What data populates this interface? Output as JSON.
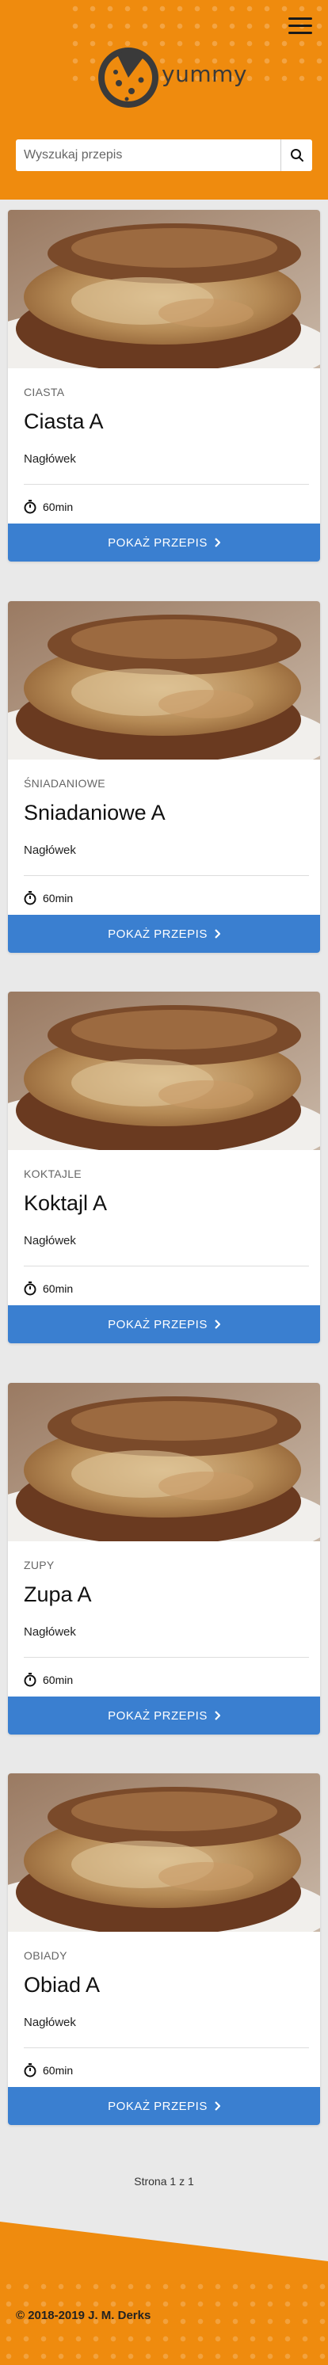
{
  "brand": {
    "name": "yummy",
    "accent": "#ef8b0e",
    "button_color": "#3a7fd0"
  },
  "header": {
    "menu_icon": "hamburger-icon"
  },
  "search": {
    "placeholder": "Wyszukaj przepis",
    "value": "",
    "icon": "search-icon"
  },
  "recipes": [
    {
      "category": "CIASTA",
      "title": "Ciasta A",
      "subtitle": "Nagłówek",
      "time": "60min",
      "button": "POKAŻ PRZEPIS"
    },
    {
      "category": "ŚNIADANIOWE",
      "title": "Sniadaniowe A",
      "subtitle": "Nagłówek",
      "time": "60min",
      "button": "POKAŻ PRZEPIS"
    },
    {
      "category": "KOKTAJLE",
      "title": "Koktajl A",
      "subtitle": "Nagłówek",
      "time": "60min",
      "button": "POKAŻ PRZEPIS"
    },
    {
      "category": "ZUPY",
      "title": "Zupa A",
      "subtitle": "Nagłówek",
      "time": "60min",
      "button": "POKAŻ PRZEPIS"
    },
    {
      "category": "OBIADY",
      "title": "Obiad A",
      "subtitle": "Nagłówek",
      "time": "60min",
      "button": "POKAŻ PRZEPIS"
    }
  ],
  "pagination": {
    "text": "Strona 1 z 1"
  },
  "footer": {
    "copyright": "© 2018-2019 J. M. Derks"
  }
}
